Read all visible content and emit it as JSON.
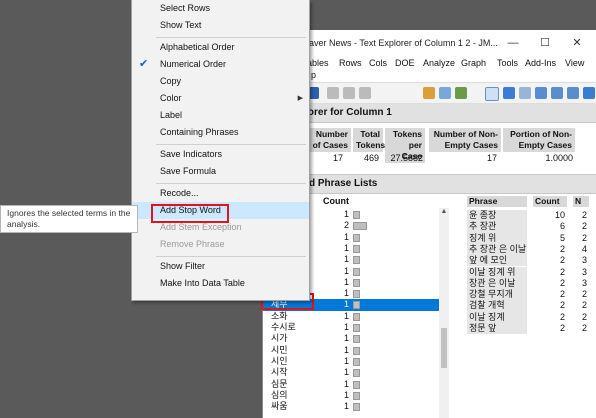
{
  "window": {
    "title": "aver News - Text Explorer of Column 1 2 - JM...",
    "menus": [
      "ables",
      "Rows",
      "Cols",
      "DOE",
      "Analyze",
      "Graph",
      "Tools",
      "Add-Ins",
      "View"
    ],
    "menu2": "p"
  },
  "report": {
    "title": "plorer for Column 1",
    "stats_headers": [
      "Number of Cases",
      "Total Tokens",
      "Tokens per Case",
      "Number of Non-Empty Cases",
      "Portion of Non-Empty Cases"
    ],
    "stats_values": [
      "17",
      "469",
      "27.5882",
      "17",
      "1.0000"
    ],
    "section_title": "d Phrase Lists"
  },
  "term_list": {
    "count_header": "Count",
    "rows": [
      {
        "term": "",
        "count": "1",
        "bar": 0.1
      },
      {
        "term": "",
        "count": "2",
        "bar": 0.2
      },
      {
        "term": "",
        "count": "1",
        "bar": 0.1
      },
      {
        "term": "",
        "count": "1",
        "bar": 0.1
      },
      {
        "term": "",
        "count": "1",
        "bar": 0.1
      },
      {
        "term": "",
        "count": "1",
        "bar": 0.1
      },
      {
        "term": "",
        "count": "1",
        "bar": 0.1
      },
      {
        "term": "",
        "count": "1",
        "bar": 0.1
      },
      {
        "term": "세무",
        "count": "1",
        "bar": 0.1,
        "selected": true
      },
      {
        "term": "소화",
        "count": "1",
        "bar": 0.1
      },
      {
        "term": "수시로",
        "count": "1",
        "bar": 0.1
      },
      {
        "term": "시가",
        "count": "1",
        "bar": 0.1
      },
      {
        "term": "시민",
        "count": "1",
        "bar": 0.1
      },
      {
        "term": "시인",
        "count": "1",
        "bar": 0.1
      },
      {
        "term": "시작",
        "count": "1",
        "bar": 0.1
      },
      {
        "term": "심문",
        "count": "1",
        "bar": 0.1
      },
      {
        "term": "심의",
        "count": "1",
        "bar": 0.1
      },
      {
        "term": "싸움",
        "count": "1",
        "bar": 0.1
      }
    ]
  },
  "phrase_list": {
    "headers": [
      "Phrase",
      "Count",
      "N"
    ],
    "rows": [
      {
        "phrase": "윤 종장",
        "count": "10",
        "n": "2"
      },
      {
        "phrase": "추 장관",
        "count": "6",
        "n": "2"
      },
      {
        "phrase": "징계 위",
        "count": "5",
        "n": "2"
      },
      {
        "phrase": "추 장관 은 이날",
        "count": "2",
        "n": "4"
      },
      {
        "phrase": "앞 에 모인",
        "count": "2",
        "n": "3"
      },
      {
        "phrase": "이날 징계 위",
        "count": "2",
        "n": "3"
      },
      {
        "phrase": "장관 은 이날",
        "count": "2",
        "n": "3"
      },
      {
        "phrase": "강철 무지개",
        "count": "2",
        "n": "2"
      },
      {
        "phrase": "검찰 개혁",
        "count": "2",
        "n": "2"
      },
      {
        "phrase": "이날 징계",
        "count": "2",
        "n": "2"
      },
      {
        "phrase": "정문 앞",
        "count": "2",
        "n": "2"
      }
    ]
  },
  "context_menu": {
    "items": [
      {
        "label": "Select Rows"
      },
      {
        "label": "Show Text"
      },
      {
        "sep": true
      },
      {
        "label": "Alphabetical Order"
      },
      {
        "label": "Numerical Order",
        "checked": true
      },
      {
        "label": "Copy"
      },
      {
        "label": "Color",
        "submenu": true
      },
      {
        "label": "Label"
      },
      {
        "label": "Containing Phrases"
      },
      {
        "sep": true
      },
      {
        "label": "Save Indicators"
      },
      {
        "label": "Save Formula"
      },
      {
        "sep": true
      },
      {
        "label": "Recode..."
      },
      {
        "label": "Add Stop Word",
        "highlight": true
      },
      {
        "label": "Add Stem Exception",
        "disabled": true
      },
      {
        "label": "Remove Phrase",
        "disabled": true
      },
      {
        "sep": true
      },
      {
        "label": "Show Filter"
      },
      {
        "label": "Make Into Data Table"
      }
    ]
  },
  "tooltip": "Ignores the selected terms in the analysis.",
  "colors": {
    "highlight_box": "#e0141e",
    "selection": "#0078d7"
  }
}
